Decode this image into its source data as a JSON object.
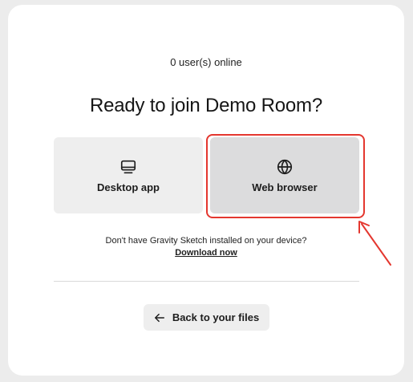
{
  "status": {
    "online_text": "0 user(s) online"
  },
  "heading": {
    "title": "Ready to join Demo Room?"
  },
  "options": {
    "desktop": {
      "label": "Desktop app",
      "icon": "monitor-icon"
    },
    "web": {
      "label": "Web browser",
      "icon": "globe-icon"
    }
  },
  "install": {
    "prompt": "Don't have Gravity Sketch installed on your device?",
    "link_label": "Download now"
  },
  "back_button": {
    "label": "Back to your files",
    "icon": "arrow-left-icon"
  },
  "annotation": {
    "highlight_color": "#e4372f"
  }
}
